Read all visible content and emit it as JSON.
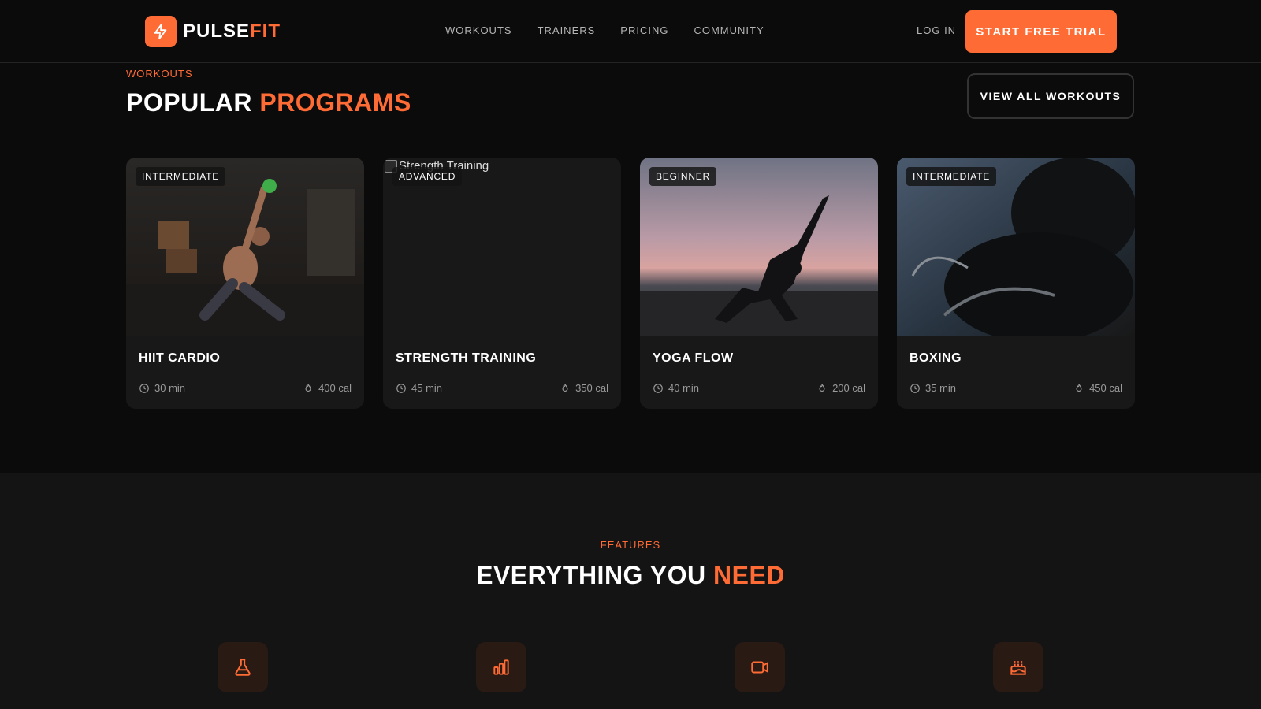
{
  "brand": {
    "name_main": "PULSE",
    "name_accent": "FIT",
    "accent_color": "#ff6b35"
  },
  "nav": {
    "items": [
      "WORKOUTS",
      "TRAINERS",
      "PRICING",
      "COMMUNITY"
    ],
    "login": "LOG IN",
    "cta": "START FREE TRIAL"
  },
  "programs": {
    "eyebrow": "WORKOUTS",
    "title_main": "POPULAR ",
    "title_accent": "PROGRAMS",
    "view_all": "VIEW ALL WORKOUTS",
    "cards": [
      {
        "title": "HIIT CARDIO",
        "level": "INTERMEDIATE",
        "duration": "30 min",
        "calories": "400 cal"
      },
      {
        "title": "STRENGTH TRAINING",
        "level": "ADVANCED",
        "duration": "45 min",
        "calories": "350 cal",
        "image_alt": "Strength Training"
      },
      {
        "title": "YOGA FLOW",
        "level": "BEGINNER",
        "duration": "40 min",
        "calories": "200 cal"
      },
      {
        "title": "BOXING",
        "level": "INTERMEDIATE",
        "duration": "35 min",
        "calories": "450 cal"
      }
    ]
  },
  "features": {
    "eyebrow": "FEATURES",
    "title_main": "EVERYTHING YOU ",
    "title_accent": "NEED",
    "icons": [
      "flask-icon",
      "bar-chart-icon",
      "video-icon",
      "cake-icon"
    ]
  }
}
